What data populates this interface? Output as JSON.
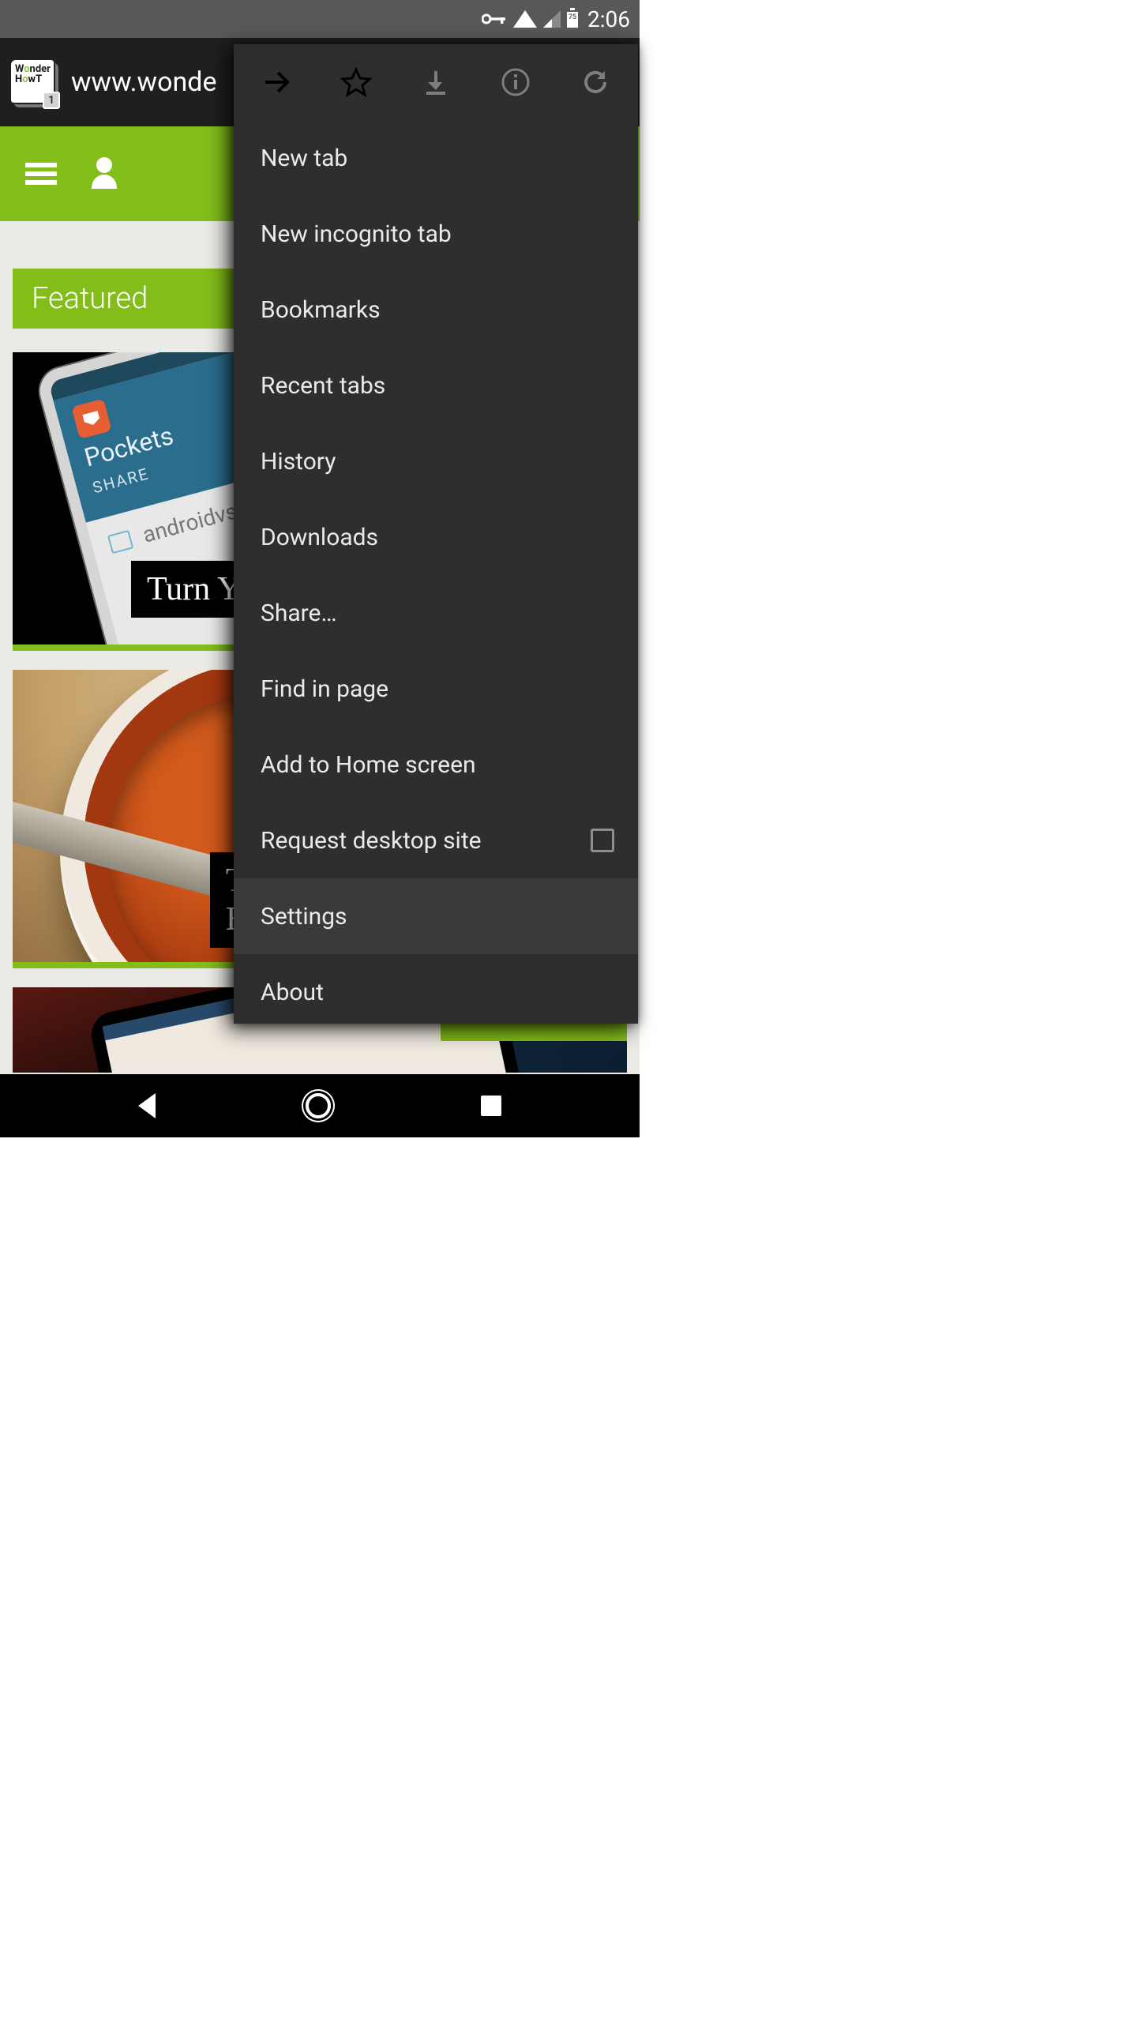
{
  "status_bar": {
    "battery_level": "75",
    "time": "2:06"
  },
  "browser": {
    "tab_count": "1",
    "url": "www.wonde",
    "icon_row": {
      "forward": "forward",
      "star": "bookmark-star",
      "download": "download",
      "info": "page-info",
      "refresh": "refresh"
    }
  },
  "menu": {
    "items": [
      {
        "label": "New tab"
      },
      {
        "label": "New incognito tab"
      },
      {
        "label": "Bookmarks"
      },
      {
        "label": "Recent tabs"
      },
      {
        "label": "History"
      },
      {
        "label": "Downloads"
      },
      {
        "label": "Share…"
      },
      {
        "label": "Find in page"
      },
      {
        "label": "Add to Home screen"
      },
      {
        "label": "Request desktop site",
        "has_checkbox": true,
        "checked": false
      },
      {
        "label": "Settings",
        "highlighted": true
      },
      {
        "label": "About"
      }
    ]
  },
  "page": {
    "section_heading": "Featured",
    "card1": {
      "app_name": "Pockets",
      "share_label": "SHARE",
      "file_name": "androidvsios.png",
      "overlay": "Turn Y"
    },
    "card2": {
      "overlay_line1": "T",
      "overlay_line2": "B"
    }
  }
}
